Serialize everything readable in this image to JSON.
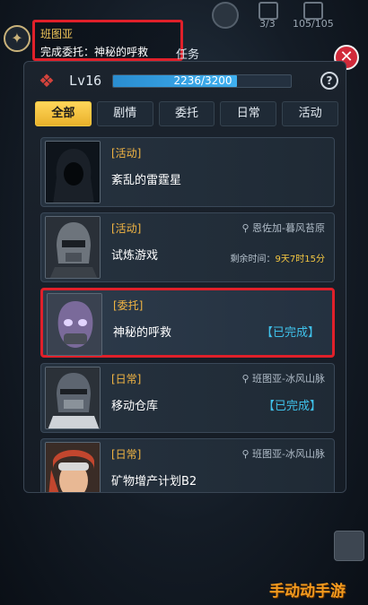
{
  "hud": {
    "count1": "3/3",
    "count2": "105/105"
  },
  "quest_tip": {
    "title": "班图亚",
    "desc": "完成委托：神秘的呼救",
    "suffix": "任务"
  },
  "panel": {
    "level": "Lv16",
    "exp": "2236/3200",
    "exp_fraction": 0.6988,
    "help": "?",
    "close": "✕"
  },
  "tabs": [
    "全部",
    "剧情",
    "委托",
    "日常",
    "活动"
  ],
  "quests": [
    {
      "tag": "[活动]",
      "name": "紊乱的雷霆星",
      "location": "",
      "status": "",
      "time_label": "",
      "time_value": ""
    },
    {
      "tag": "[活动]",
      "name": "试炼游戏",
      "location": "恩佐加-暮风苔原",
      "status": "",
      "time_label": "剩余时间：",
      "time_value": "9天7时15分"
    },
    {
      "tag": "[委托]",
      "name": "神秘的呼救",
      "location": "",
      "status": "【已完成】",
      "time_label": "",
      "time_value": ""
    },
    {
      "tag": "[日常]",
      "name": "移动仓库",
      "location": "班图亚-冰风山脉",
      "status": "【已完成】",
      "time_label": "",
      "time_value": ""
    },
    {
      "tag": "[日常]",
      "name": "矿物增产计划B2",
      "location": "班图亚-冰风山脉",
      "status": "",
      "time_label": "",
      "time_value": ""
    }
  ],
  "watermark": "手动动手游",
  "colors": {
    "highlight": "#e0202a",
    "active_tab": "#f5c842",
    "tag": "#f2b543",
    "completed": "#3fc1ea"
  }
}
